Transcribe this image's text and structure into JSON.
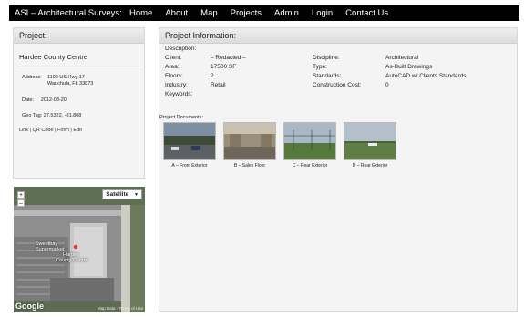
{
  "header": {
    "brand": "ASI – Architectural Surveys:",
    "nav": [
      "Home",
      "About",
      "Map",
      "Projects",
      "Admin",
      "Login",
      "Contact Us"
    ]
  },
  "left": {
    "title": "Project:",
    "project_name": "Hardee County Centre",
    "address_label": "Address:",
    "address_line1": "1103 US Hwy 17",
    "address_line2": "Wauchula, FL 33873",
    "date_label": "Date:",
    "date": "2012-08-20",
    "geotag_label": "Geo Tag:",
    "geotag": "27.5322, -81.808",
    "link": "Link",
    "qr": "QR Code",
    "form": "Form",
    "edit": "Edit",
    "sep": "|"
  },
  "map": {
    "type_button": "Satellite",
    "zoom_in": "+",
    "zoom_out": "–",
    "label1": "Sweetbay",
    "label2": "Supermarket",
    "label3": "Hardee",
    "label4": "County Centre",
    "logo": "Google",
    "data": "Map Data",
    "terms": "Terms of Use"
  },
  "info": {
    "title": "Project Information:",
    "description_label": "Description:",
    "client_label": "Client:",
    "client": "– Redacted –",
    "area_label": "Area:",
    "area": "17500 SF",
    "floors_label": "Floors:",
    "floors": "2",
    "industry_label": "Industry:",
    "industry": "Retail",
    "keywords_label": "Keywords:",
    "discipline_label": "Discipline:",
    "discipline": "Architectural",
    "type_label": "Type:",
    "type": "As-Built Drawings",
    "standards_label": "Standards:",
    "standards": "AutoCAD w/ Clients Standards",
    "cost_label": "Construction Cost:",
    "cost": "0"
  },
  "documents": {
    "label": "Project Documents:",
    "items": [
      {
        "caption": "A – Front Exterior"
      },
      {
        "caption": "B – Sales Floor"
      },
      {
        "caption": "C – Rear Exterior"
      },
      {
        "caption": "D – Rear Exterior"
      }
    ]
  }
}
